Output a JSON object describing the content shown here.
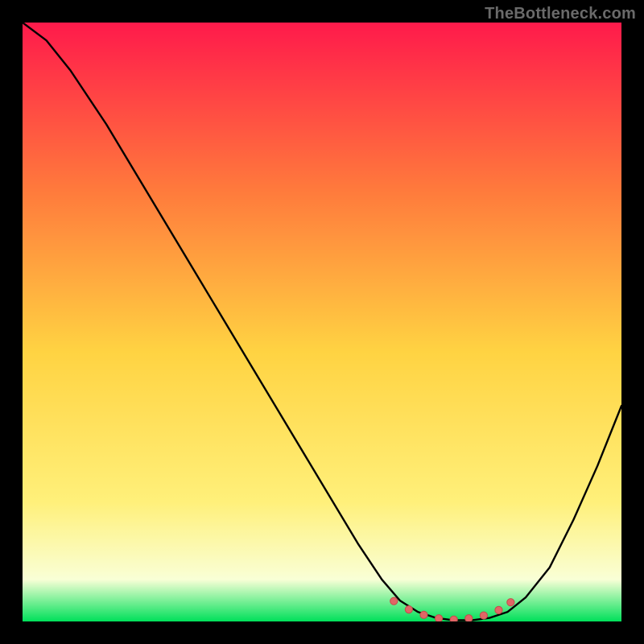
{
  "watermark": "TheBottleneck.com",
  "colors": {
    "bg": "#000000",
    "curve": "#000000",
    "marker_fill": "#e06666",
    "marker_stroke": "#c44a4a",
    "grad_top": "#ff1a4b",
    "grad_upper_mid": "#ff7a3c",
    "grad_mid": "#ffd342",
    "grad_lower_mid": "#fff07a",
    "grad_low": "#f9ffd6",
    "grad_bottom": "#00e05a"
  },
  "chart_data": {
    "type": "line",
    "title": "",
    "xlabel": "",
    "ylabel": "",
    "xlim": [
      0,
      100
    ],
    "ylim": [
      0,
      100
    ],
    "series": [
      {
        "name": "bottleneck-curve",
        "x": [
          0,
          4,
          8,
          14,
          20,
          26,
          32,
          38,
          44,
          50,
          56,
          60,
          63,
          66,
          69,
          72,
          75,
          78,
          81,
          84,
          88,
          92,
          96,
          100
        ],
        "y": [
          100,
          97,
          92,
          83,
          73,
          63,
          53,
          43,
          33,
          23,
          13,
          7,
          3.5,
          1.6,
          0.6,
          0.2,
          0.2,
          0.6,
          1.6,
          4,
          9,
          17,
          26,
          36
        ]
      }
    ],
    "markers": {
      "name": "optimal-range",
      "x": [
        62,
        64.5,
        67,
        69.5,
        72,
        74.5,
        77,
        79.5,
        81.5
      ],
      "y": [
        3.4,
        2.0,
        1.1,
        0.5,
        0.3,
        0.5,
        1.0,
        1.9,
        3.2
      ]
    }
  }
}
